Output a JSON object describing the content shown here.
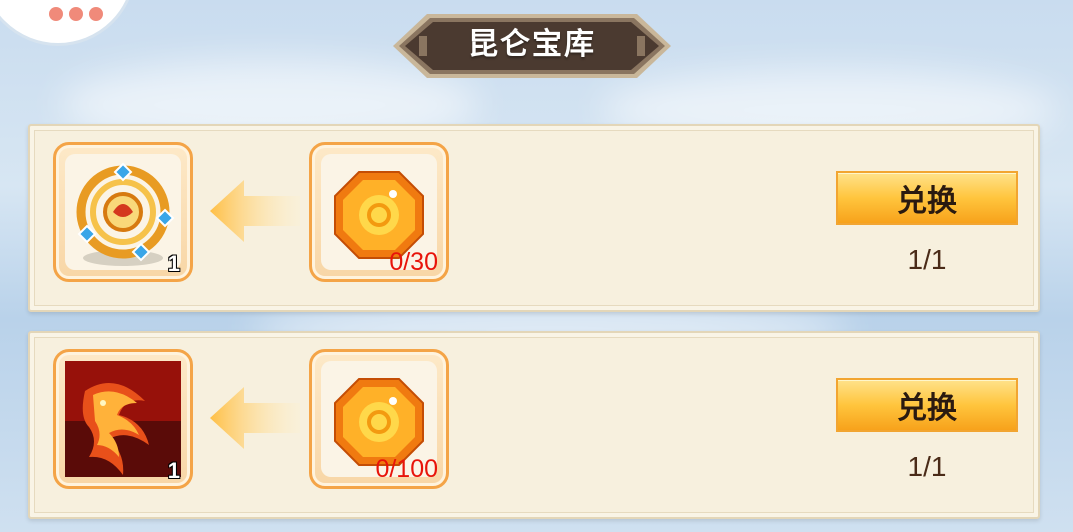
{
  "header": {
    "title": "昆仑宝库"
  },
  "items": [
    {
      "reward_icon": "phoenix-ring-icon",
      "reward_count": "1",
      "cost_icon": "orange-gem-icon",
      "cost_progress": "0/30",
      "exchange_label": "兑换",
      "limit": "1/1"
    },
    {
      "reward_icon": "red-dragon-icon",
      "reward_count": "1",
      "cost_icon": "orange-gem-icon",
      "cost_progress": "0/100",
      "exchange_label": "兑换",
      "limit": "1/1"
    }
  ],
  "colors": {
    "accent_button": "#ffc53d",
    "cost_text": "#e8140a",
    "banner": "#4b3a30"
  }
}
